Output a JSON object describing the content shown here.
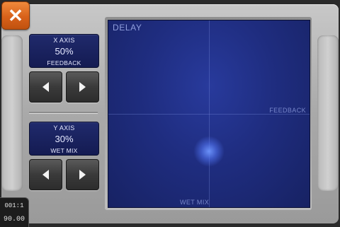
{
  "close_button": {
    "glyph": "✕",
    "icon": "close-icon"
  },
  "x_axis": {
    "title": "X AXIS",
    "value": "50%",
    "param": "FEEDBACK",
    "fraction": 0.5
  },
  "y_axis": {
    "title": "Y AXIS",
    "value": "30%",
    "param": "WET MIX",
    "fraction": 0.3
  },
  "pad": {
    "title": "DELAY",
    "x_label": "FEEDBACK",
    "y_label": "WET MIX"
  },
  "counter": {
    "position": "001:1",
    "tempo": "90.00"
  },
  "colors": {
    "accent": "#d8611a",
    "pad_blue": "#1f2d80",
    "display_blue": "#1a2260"
  }
}
